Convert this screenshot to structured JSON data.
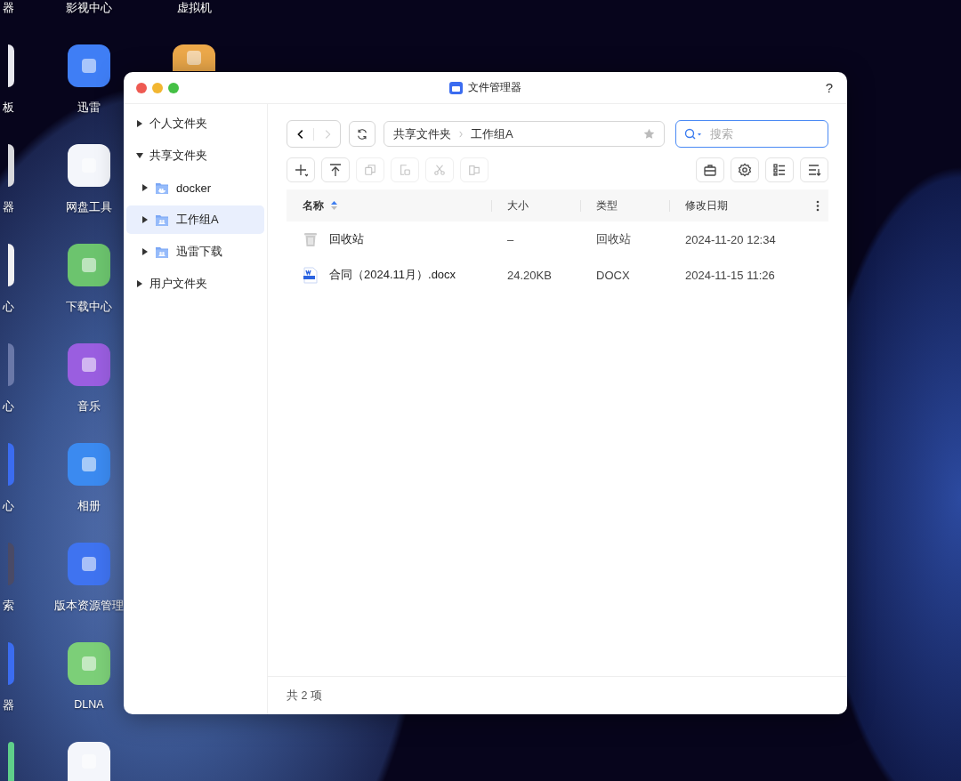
{
  "desktop": {
    "columns": [
      {
        "items": [
          {
            "label": "器"
          },
          {
            "label": "板",
            "color": "#e8e8ee"
          },
          {
            "label": "器",
            "color": "#d8d8dc"
          },
          {
            "label": "心",
            "color": "#f0f0f2"
          },
          {
            "label": "心",
            "color": "#6a78a8"
          },
          {
            "label": "心",
            "color": "#3b6cf0"
          },
          {
            "label": "索",
            "color": "#4a4a66"
          },
          {
            "label": "器",
            "color": "#3b6cf0"
          },
          {
            "color": "#5fcf8a"
          }
        ]
      },
      {
        "items": [
          {
            "label": "影视中心"
          },
          {
            "label": "迅雷",
            "color": "#3f7ef5"
          },
          {
            "label": "网盘工具",
            "color": "#f4f6fb"
          },
          {
            "label": "下载中心",
            "color": "#6cc46e"
          },
          {
            "label": "音乐",
            "color": "#9a5ee0"
          },
          {
            "label": "相册",
            "color": "#3b8af0"
          },
          {
            "label": "版本资源管理",
            "color": "#3f73f0"
          },
          {
            "label": "DLNA",
            "color": "#7ccf78"
          },
          {
            "color": "#f4f6fb"
          }
        ]
      },
      {
        "items": [
          {
            "label": "虚拟机"
          },
          {
            "color": "#eda94a"
          }
        ]
      }
    ]
  },
  "window": {
    "title": "文件管理器",
    "help": "?",
    "sidebar": {
      "items": [
        {
          "label": "个人文件夹",
          "expanded": false,
          "selected": false
        },
        {
          "label": "共享文件夹",
          "expanded": true,
          "selected": false,
          "children": [
            {
              "label": "docker",
              "kind": "docker",
              "expanded": false,
              "selected": false
            },
            {
              "label": "工作组A",
              "kind": "group",
              "expanded": false,
              "selected": true
            },
            {
              "label": "迅雷下载",
              "kind": "group",
              "expanded": false,
              "selected": false
            }
          ]
        },
        {
          "label": "用户文件夹",
          "expanded": false,
          "selected": false
        }
      ]
    },
    "nav": [
      {
        "kind": "back",
        "disabled": false
      },
      {
        "kind": "forward",
        "disabled": true
      }
    ],
    "breadcrumb": [
      "共享文件夹",
      "工作组A"
    ],
    "search": {
      "placeholder": "搜索"
    },
    "toolbar_left": [
      {
        "kind": "add",
        "disabled": false
      },
      {
        "kind": "upload",
        "disabled": false
      },
      {
        "kind": "copy",
        "disabled": true
      },
      {
        "kind": "paste",
        "disabled": true
      },
      {
        "kind": "cut",
        "disabled": true
      },
      {
        "kind": "move",
        "disabled": true
      }
    ],
    "toolbar_right": [
      {
        "kind": "tools"
      },
      {
        "kind": "settings"
      },
      {
        "kind": "view"
      },
      {
        "kind": "sort"
      }
    ],
    "table": {
      "columns": [
        {
          "label": "名称",
          "sorted": true
        },
        {
          "label": "大小",
          "sorted": false
        },
        {
          "label": "类型",
          "sorted": false
        },
        {
          "label": "修改日期",
          "sorted": false
        }
      ],
      "rows": [
        {
          "kind": "trash",
          "name": "回收站",
          "size": "–",
          "type": "回收站",
          "modified": "2024-11-20 12:34"
        },
        {
          "kind": "docx",
          "name": "合同（2024.11月）.docx",
          "size": "24.20KB",
          "type": "DOCX",
          "modified": "2024-11-15 11:26"
        }
      ]
    },
    "status": "共 2 项"
  }
}
